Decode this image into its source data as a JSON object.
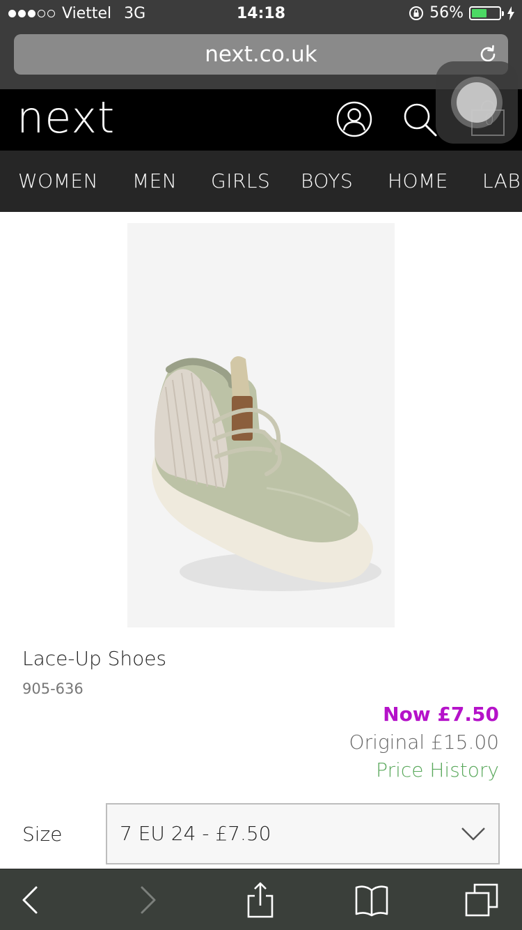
{
  "status_bar": {
    "carrier": "Viettel",
    "network": "3G",
    "time": "14:18",
    "battery_percent": "56%",
    "battery_level": 0.56,
    "signal_bars": 3
  },
  "browser": {
    "url": "next.co.uk"
  },
  "header": {
    "logo": "next",
    "bag_count": "0"
  },
  "nav": {
    "items": [
      "WOMEN",
      "MEN",
      "GIRLS",
      "BOYS",
      "HOME",
      "LAB"
    ]
  },
  "product": {
    "title": "Lace-Up Shoes",
    "code": "905-636",
    "price_now": "Now £7.50",
    "price_original": "Original £15.00",
    "price_history": "Price History",
    "size_label": "Size",
    "size_selected": "7 EU 24 - £7.50"
  },
  "colors": {
    "accent_now_price": "#b512c9",
    "price_history_link": "#59a85b",
    "header_bg": "#000000",
    "nav_bg": "#262626"
  }
}
